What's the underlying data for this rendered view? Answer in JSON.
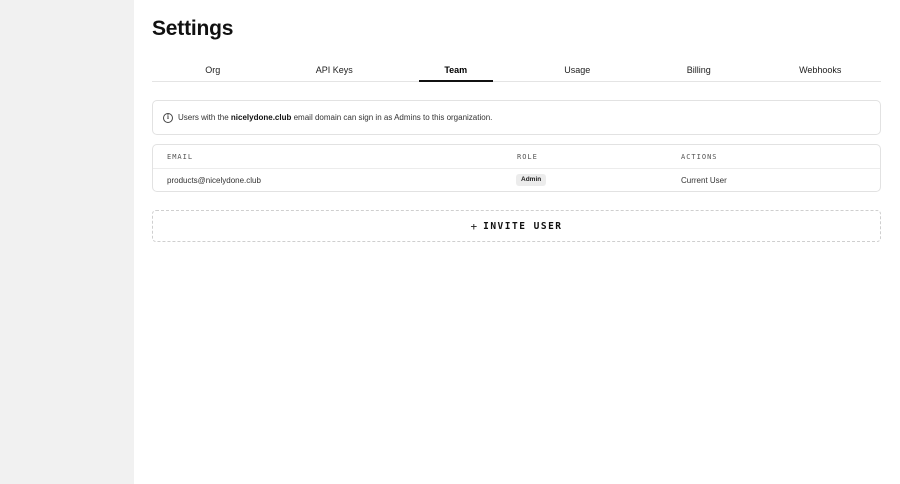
{
  "page": {
    "title": "Settings"
  },
  "tabs": [
    {
      "label": "Org"
    },
    {
      "label": "API Keys"
    },
    {
      "label": "Team",
      "active": true
    },
    {
      "label": "Usage"
    },
    {
      "label": "Billing"
    },
    {
      "label": "Webhooks"
    }
  ],
  "info": {
    "icon": "info-icon",
    "prefix": "Users with the ",
    "domain": "nicelydone.club",
    "suffix": " email domain can sign in as Admins to this organization."
  },
  "table": {
    "columns": {
      "email": "EMAIL",
      "role": "ROLE",
      "actions": "ACTIONS"
    },
    "rows": [
      {
        "email": "products@nicelydone.club",
        "role": "Admin",
        "action": "Current User"
      }
    ]
  },
  "invite": {
    "icon": "plus-icon",
    "label": "INVITE USER"
  }
}
